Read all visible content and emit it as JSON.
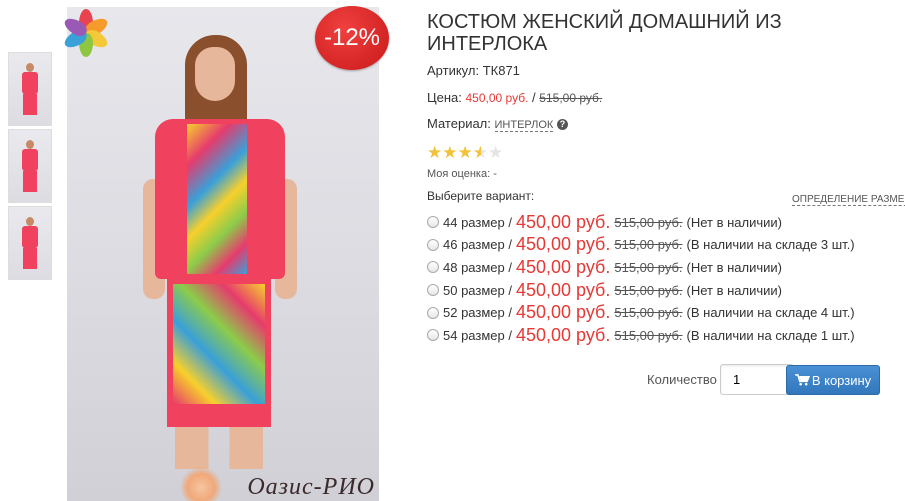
{
  "badge": {
    "discount": "-12%"
  },
  "product": {
    "title": "КОСТЮМ ЖЕНСКИЙ ДОМАШНИЙ ИЗ ИНТЕРЛОКА",
    "sku_label": "Артикул:",
    "sku_value": "ТК871",
    "price_label": "Цена:",
    "price": "450,00 руб.",
    "price_sep": "/",
    "old_price": "515,00 руб.",
    "material_label": "Материал:",
    "material_value": "ИНТЕРЛОК",
    "help_glyph": "?",
    "rating": 3.5,
    "rating_max": 5,
    "my_rating": "Моя оценка: -"
  },
  "variants": {
    "label": "Выберите вариант:",
    "size_link": "ОПРЕДЕЛЕНИЕ РАЗМЕРА",
    "items": [
      {
        "size": "44 размер /",
        "price": "450,00 руб.",
        "old": "515,00 руб.",
        "status": "(Нет в наличии)"
      },
      {
        "size": "46 размер /",
        "price": "450,00 руб.",
        "old": "515,00 руб.",
        "status": "(В наличии на складе 3 шт.)"
      },
      {
        "size": "48 размер /",
        "price": "450,00 руб.",
        "old": "515,00 руб.",
        "status": "(Нет в наличии)"
      },
      {
        "size": "50 размер /",
        "price": "450,00 руб.",
        "old": "515,00 руб.",
        "status": "(Нет в наличии)"
      },
      {
        "size": "52 размер /",
        "price": "450,00 руб.",
        "old": "515,00 руб.",
        "status": "(В наличии на складе 4 шт.)"
      },
      {
        "size": "54 размер /",
        "price": "450,00 руб.",
        "old": "515,00 руб.",
        "status": "(В наличии на складе 1 шт.)"
      }
    ]
  },
  "cart": {
    "qty_label": "Количество",
    "qty_value": "1",
    "button_label": "В корзину"
  },
  "watermark": "Оазис-РИО",
  "colors": {
    "accent_red": "#e53935",
    "button_blue": "#3277bb",
    "garment_pink": "#f0425f"
  },
  "icons": {
    "help": "question-circle-icon",
    "cart": "shopping-cart-icon",
    "star": "star-icon",
    "logo": "flower-logo-icon"
  }
}
